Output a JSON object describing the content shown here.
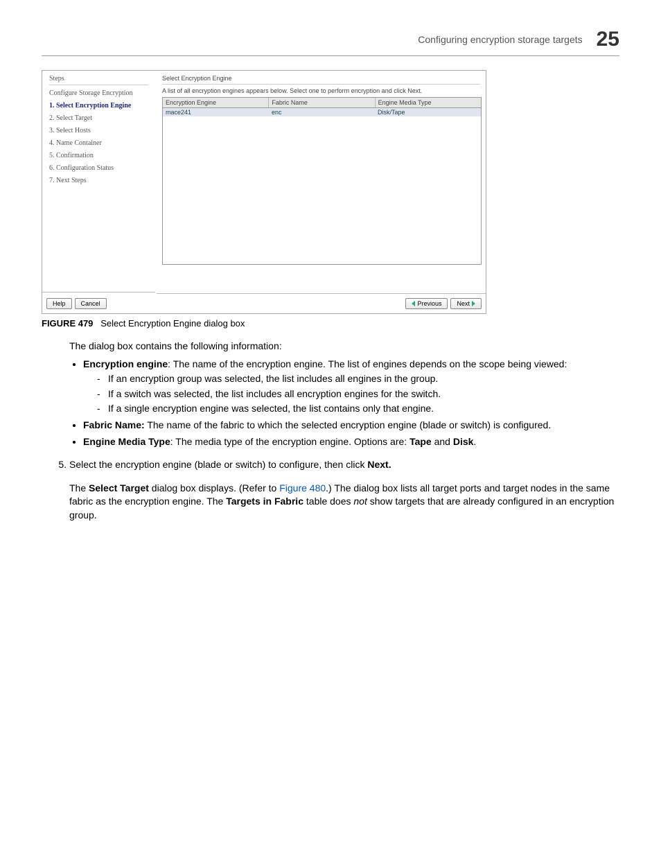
{
  "header": {
    "title": "Configuring encryption storage targets",
    "chapter": "25"
  },
  "figure": {
    "label": "FIGURE 479",
    "caption": "Select Encryption Engine dialog box",
    "stepsTitle": "Steps",
    "stepsHeader": "Configure Storage Encryption",
    "steps": [
      "1. Select Encryption Engine",
      "2. Select Target",
      "3. Select Hosts",
      "4. Name Container",
      "5. Confirmation",
      "6. Configuration Status",
      "7. Next Steps"
    ],
    "rightTitle": "Select Encryption Engine",
    "rightDesc": "A list of all encryption engines appears below. Select one to perform encryption and click Next.",
    "columns": {
      "c1": "Encryption Engine",
      "c2": "Fabric Name",
      "c3": "Engine Media Type"
    },
    "row": {
      "c1": "mace241",
      "c2": "enc",
      "c3": "Disk/Tape"
    },
    "buttons": {
      "help": "Help",
      "cancel": "Cancel",
      "prev": "Previous",
      "next": "Next"
    }
  },
  "body": {
    "intro": "The dialog box contains the following information:",
    "bullets": {
      "b1_bold": "Encryption engine",
      "b1_rest": ": The name of the encryption engine. The list of engines depends on the scope being viewed:",
      "b1_d1": "If an encryption group was selected, the list includes all engines in the group.",
      "b1_d2": "If a switch was selected, the list includes all encryption engines for the switch.",
      "b1_d3": "If a single encryption engine was selected, the list contains only that engine.",
      "b2_bold": "Fabric Name:",
      "b2_rest": " The name of the fabric to which the selected encryption engine (blade or switch) is configured.",
      "b3_bold": "Engine Media Type",
      "b3_rest_a": ": The media type of the encryption engine. Options are: ",
      "b3_tape": "Tape",
      "b3_and": " and ",
      "b3_disk": "Disk",
      "b3_period": "."
    },
    "step5": {
      "text_a": "Select the encryption engine (blade or switch) to configure, then click ",
      "next": "Next.",
      "p2_a": "The ",
      "p2_b": "Select Target",
      "p2_c": " dialog box displays. (Refer to ",
      "p2_link": "Figure 480",
      "p2_d": ".) The dialog box lists all target ports and target nodes in the same fabric as the encryption engine. The ",
      "p2_e": "Targets in Fabric",
      "p2_f": " table does ",
      "p2_not": "not",
      "p2_g": " show targets that are already configured in an encryption group."
    }
  }
}
